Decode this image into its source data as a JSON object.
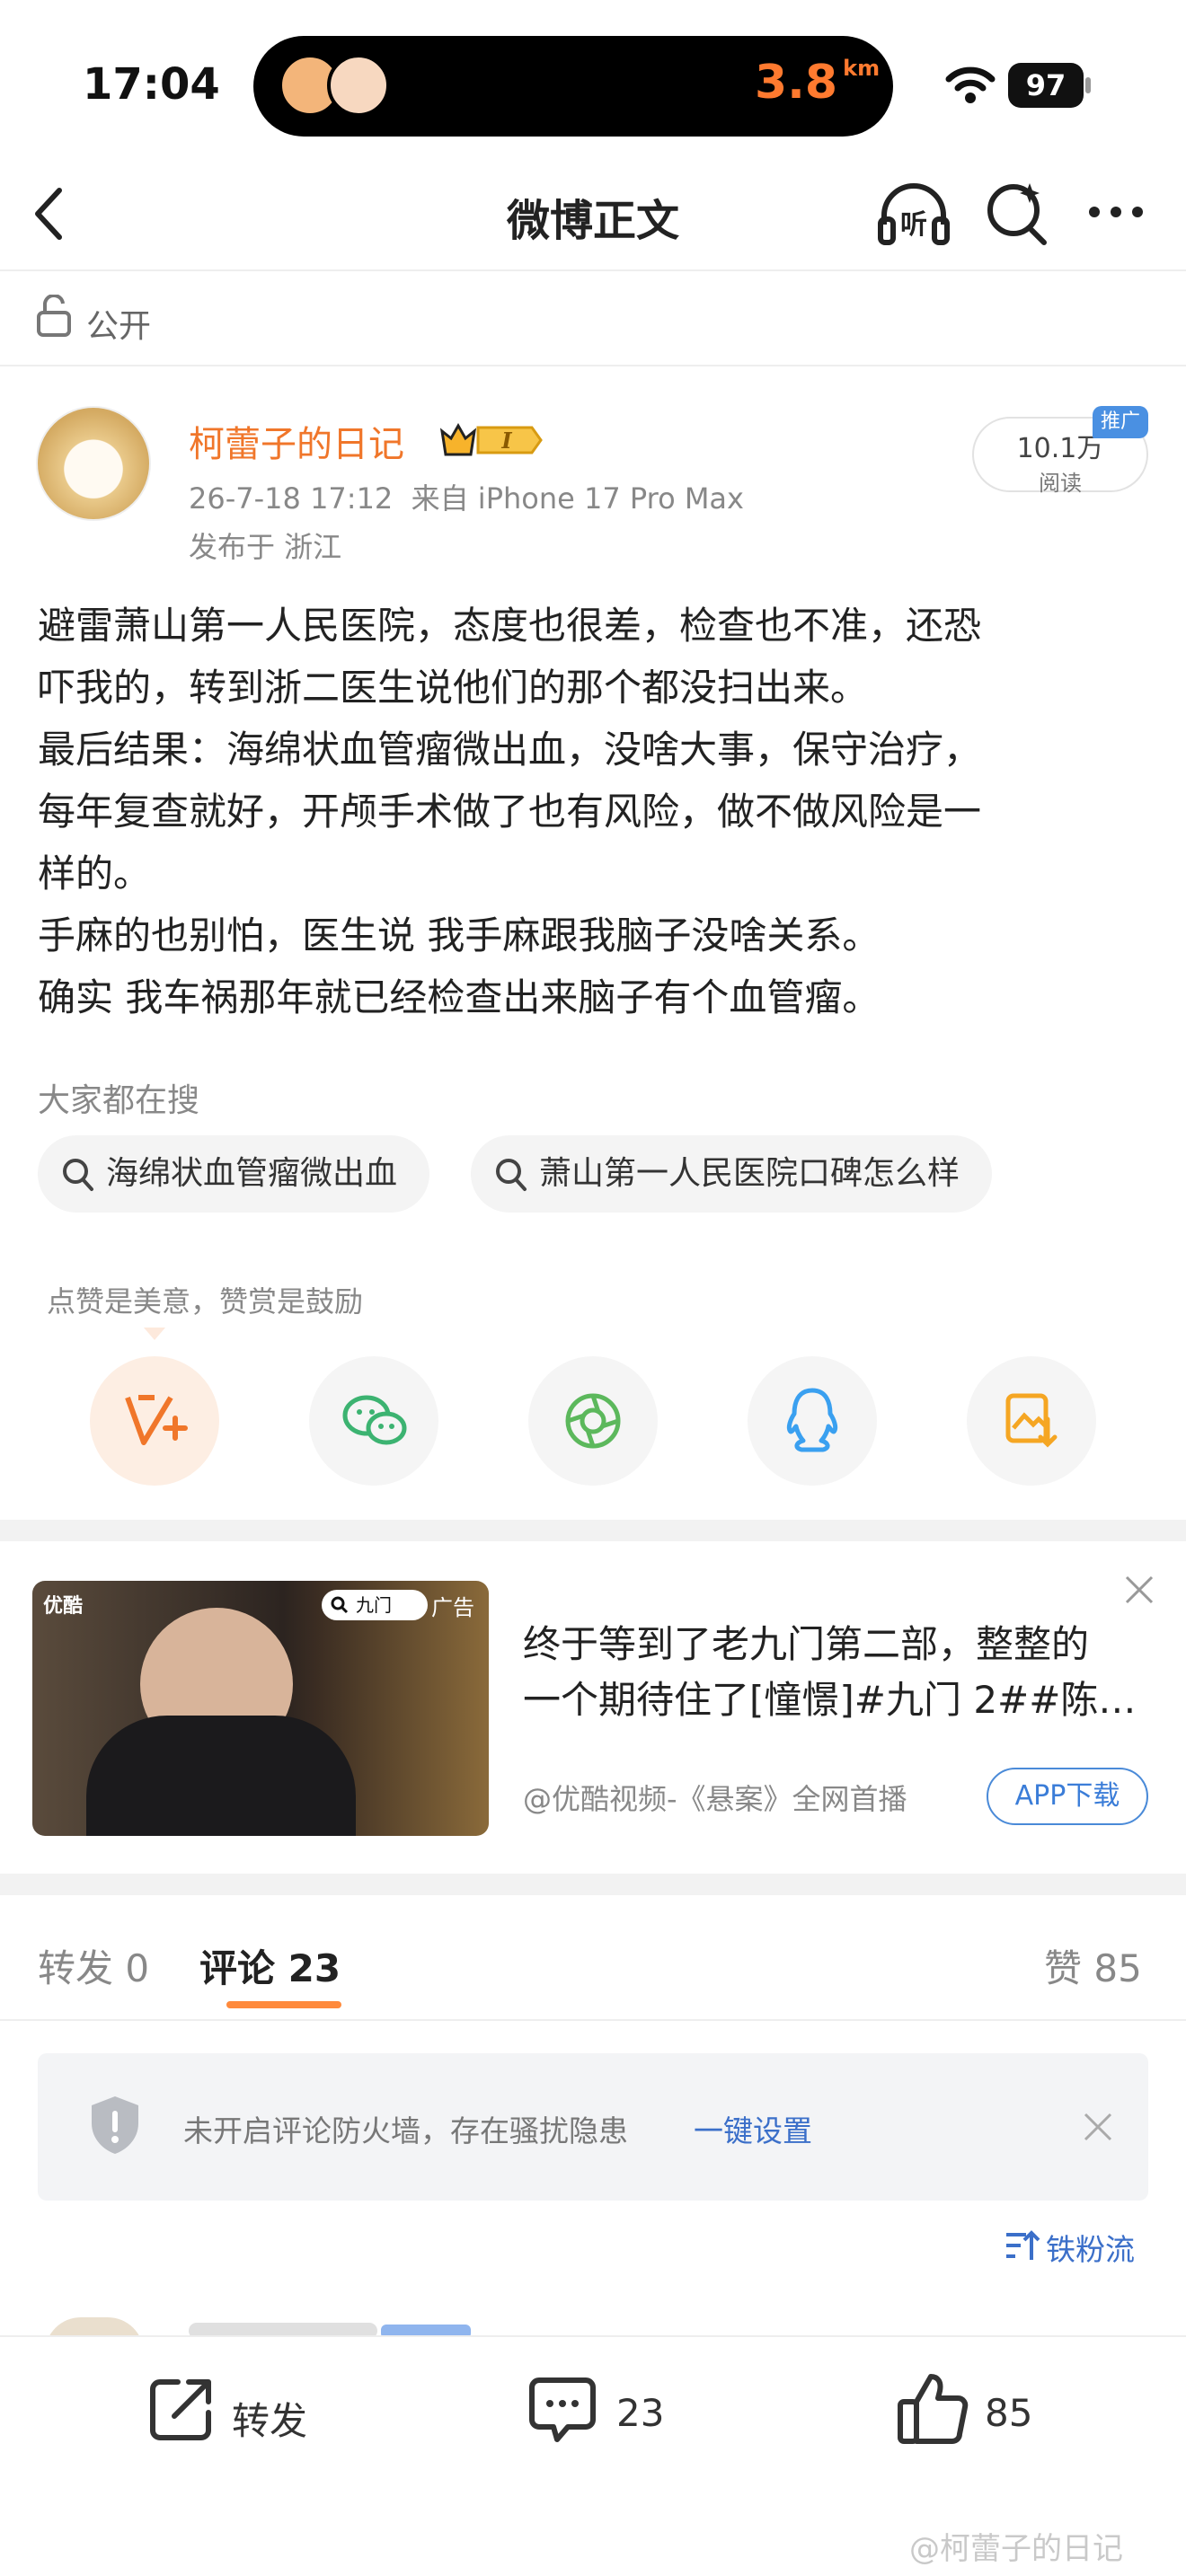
{
  "status_bar": {
    "time": "17:04",
    "distance": "3.8",
    "distance_unit": "km",
    "battery": "97"
  },
  "nav": {
    "title": "微博正文",
    "back_icon": "chevron-left-icon",
    "listen_icon": "listen-icon",
    "search_icon": "search-sparkle-icon",
    "more_icon": "more-icon"
  },
  "visibility": {
    "label": "公开",
    "icon": "unlock-icon"
  },
  "post": {
    "author": "柯蕾子的日记",
    "badge": "I",
    "date": "26-7-18 17:12",
    "source": "来自 iPhone 17 Pro Max",
    "location": "发布于 浙江",
    "reads_value": "10.1万",
    "reads_label": "阅读",
    "promo_tag": "推广",
    "lines": [
      "避雷萧山第一人民医院，态度也很差，检查也不准，还恐",
      "吓我的，转到浙二医生说他们的那个都没扫出来。",
      "最后结果：海绵状血管瘤微出血，没啥大事，保守治疗，",
      "每年复查就好，开颅手术做了也有风险，做不做风险是一",
      "样的。",
      "手麻的也别怕，医生说 我手麻跟我脑子没啥关系。",
      "确实 我车祸那年就已经检查出来脑子有个血管瘤。"
    ]
  },
  "trending": {
    "label": "大家都在搜",
    "chips": [
      "海绵状血管瘤微出血",
      "萧山第一人民医院口碑怎么样"
    ]
  },
  "share": {
    "hint": "点赞是美意，赞赏是鼓励",
    "buttons": [
      "reward-icon",
      "wechat-icon",
      "moments-icon",
      "qq-icon",
      "save-image-icon"
    ]
  },
  "ad": {
    "thumb_brand": "优酷",
    "thumb_search": "九门",
    "thumb_tag": "广告",
    "text_line1": "终于等到了老九门第二部，整整的",
    "text_line2": "一个期待住了[憧憬]#九门 2##陈…",
    "source": "@优酷视频-《悬案》全网首播",
    "button": "APP下载"
  },
  "tabs": {
    "repost": "转发 0",
    "comments": "评论 23",
    "likes": "赞 85"
  },
  "firewall": {
    "text": "未开启评论防火墙，存在骚扰隐患",
    "link": "一键设置"
  },
  "sort_label": "铁粉流",
  "bottom_bar": {
    "repost_label": "转发",
    "comment_count": "23",
    "like_count": "85"
  },
  "watermark": "@柯蕾子的日记",
  "colors": {
    "accent_orange": "#f0762a",
    "link_blue": "#3b6fc9"
  }
}
